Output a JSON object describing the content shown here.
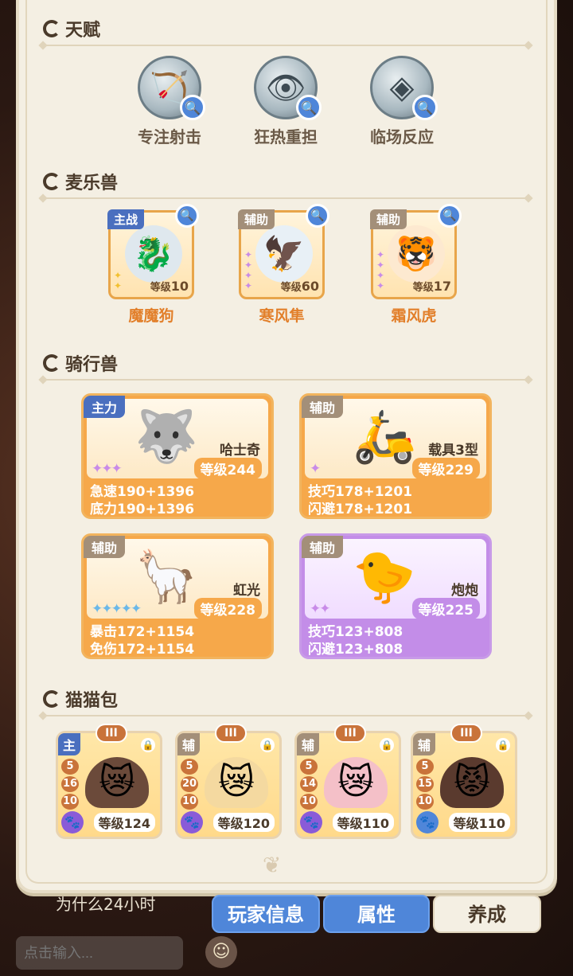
{
  "sections": {
    "talent": "天赋",
    "pets": "麦乐兽",
    "mounts": "骑行兽",
    "catbags": "猫猫包"
  },
  "talents": [
    {
      "name": "专注射击",
      "icon": "bow-icon"
    },
    {
      "name": "狂热重担",
      "icon": "eye-shield-icon"
    },
    {
      "name": "临场反应",
      "icon": "diamond-icon"
    }
  ],
  "pets": [
    {
      "tag": "主战",
      "name": "魔魔狗",
      "level_label": "等级",
      "level": "10"
    },
    {
      "tag": "辅助",
      "name": "寒风隼",
      "level_label": "等级",
      "level": "60"
    },
    {
      "tag": "辅助",
      "name": "霜风虎",
      "level_label": "等级",
      "level": "17"
    }
  ],
  "mounts": [
    {
      "tag": "主力",
      "name": "哈士奇",
      "level": "等级244",
      "stat1": "急速190+1396",
      "stat2": "底力190+1396"
    },
    {
      "tag": "辅助",
      "name": "载具3型",
      "level": "等级229",
      "stat1": "技巧178+1201",
      "stat2": "闪避178+1201"
    },
    {
      "tag": "辅助",
      "name": "虹光",
      "level": "等级228",
      "stat1": "暴击172+1154",
      "stat2": "免伤172+1154"
    },
    {
      "tag": "辅助",
      "name": "炮炮",
      "level": "等级225",
      "stat1": "技巧123+808",
      "stat2": "闪避123+808"
    }
  ],
  "catbags": [
    {
      "tag": "主",
      "rank": "III",
      "nums": [
        "5",
        "16",
        "10"
      ],
      "level": "等级124"
    },
    {
      "tag": "辅",
      "rank": "III",
      "nums": [
        "5",
        "20",
        "10"
      ],
      "level": "等级120"
    },
    {
      "tag": "辅",
      "rank": "III",
      "nums": [
        "5",
        "14",
        "10"
      ],
      "level": "等级110"
    },
    {
      "tag": "辅",
      "rank": "III",
      "nums": [
        "5",
        "15",
        "10"
      ],
      "level": "等级110"
    }
  ],
  "chat": {
    "message": "为什么24小时",
    "input_placeholder": "点击输入..."
  },
  "tabs": [
    "玩家信息",
    "属性",
    "养成"
  ],
  "colors": {
    "panel": "#f4efe3",
    "accent_blue": "#4f86d9",
    "orange": "#f6a84a",
    "purple": "#c38de8"
  }
}
